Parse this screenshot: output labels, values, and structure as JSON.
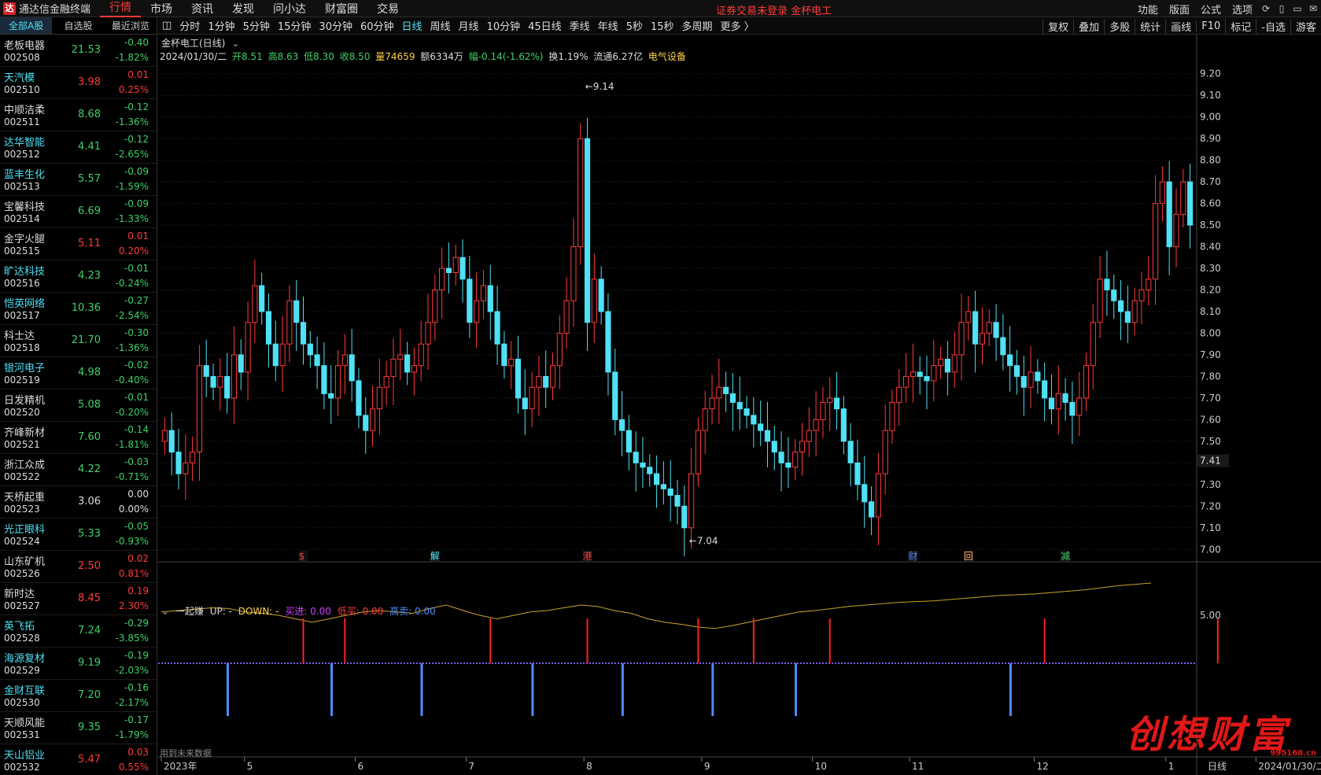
{
  "app": {
    "title": "通达信金融终端",
    "logo": "达",
    "login_warning": "证券交易未登录  金杯电工"
  },
  "menu": [
    "行情",
    "市场",
    "资讯",
    "发现",
    "问小达",
    "财富圈",
    "交易"
  ],
  "menu_active": 0,
  "right_menu": [
    "功能",
    "版面",
    "公式",
    "选项"
  ],
  "sidebar": {
    "tabs": [
      "全部A股",
      "自选股",
      "最近浏览"
    ],
    "stocks": [
      {
        "name": "老板电器",
        "code": "002508",
        "price": "21.53",
        "chg": "-0.40",
        "pct": "-1.82%",
        "dir": "dn",
        "cyan": false
      },
      {
        "name": "天汽模",
        "code": "002510",
        "price": "3.98",
        "chg": "0.01",
        "pct": "0.25%",
        "dir": "up",
        "cyan": true
      },
      {
        "name": "中顺洁柔",
        "code": "002511",
        "price": "8.68",
        "chg": "-0.12",
        "pct": "-1.36%",
        "dir": "dn",
        "cyan": false
      },
      {
        "name": "达华智能",
        "code": "002512",
        "price": "4.41",
        "chg": "-0.12",
        "pct": "-2.65%",
        "dir": "dn",
        "cyan": true
      },
      {
        "name": "蓝丰生化",
        "code": "002513",
        "price": "5.57",
        "chg": "-0.09",
        "pct": "-1.59%",
        "dir": "dn",
        "cyan": true
      },
      {
        "name": "宝馨科技",
        "code": "002514",
        "price": "6.69",
        "chg": "-0.09",
        "pct": "-1.33%",
        "dir": "dn",
        "cyan": false
      },
      {
        "name": "金字火腿",
        "code": "002515",
        "price": "5.11",
        "chg": "0.01",
        "pct": "0.20%",
        "dir": "up",
        "cyan": false
      },
      {
        "name": "旷达科技",
        "code": "002516",
        "price": "4.23",
        "chg": "-0.01",
        "pct": "-0.24%",
        "dir": "dn",
        "cyan": true
      },
      {
        "name": "恺英网络",
        "code": "002517",
        "price": "10.36",
        "chg": "-0.27",
        "pct": "-2.54%",
        "dir": "dn",
        "cyan": true
      },
      {
        "name": "科士达",
        "code": "002518",
        "price": "21.70",
        "chg": "-0.30",
        "pct": "-1.36%",
        "dir": "dn",
        "cyan": false
      },
      {
        "name": "银河电子",
        "code": "002519",
        "price": "4.98",
        "chg": "-0.02",
        "pct": "-0.40%",
        "dir": "dn",
        "cyan": true
      },
      {
        "name": "日发精机",
        "code": "002520",
        "price": "5.08",
        "chg": "-0.01",
        "pct": "-0.20%",
        "dir": "dn",
        "cyan": false
      },
      {
        "name": "齐峰新材",
        "code": "002521",
        "price": "7.60",
        "chg": "-0.14",
        "pct": "-1.81%",
        "dir": "dn",
        "cyan": false
      },
      {
        "name": "浙江众成",
        "code": "002522",
        "price": "4.22",
        "chg": "-0.03",
        "pct": "-0.71%",
        "dir": "dn",
        "cyan": false
      },
      {
        "name": "天桥起重",
        "code": "002523",
        "price": "3.06",
        "chg": "0.00",
        "pct": "0.00%",
        "dir": "flat",
        "cyan": false
      },
      {
        "name": "光正眼科",
        "code": "002524",
        "price": "5.33",
        "chg": "-0.05",
        "pct": "-0.93%",
        "dir": "dn",
        "cyan": true
      },
      {
        "name": "山东矿机",
        "code": "002526",
        "price": "2.50",
        "chg": "0.02",
        "pct": "0.81%",
        "dir": "up",
        "cyan": false
      },
      {
        "name": "新时达",
        "code": "002527",
        "price": "8.45",
        "chg": "0.19",
        "pct": "2.30%",
        "dir": "up",
        "cyan": false
      },
      {
        "name": "英飞拓",
        "code": "002528",
        "price": "7.24",
        "chg": "-0.29",
        "pct": "-3.85%",
        "dir": "dn",
        "cyan": true
      },
      {
        "name": "海源复材",
        "code": "002529",
        "price": "9.19",
        "chg": "-0.19",
        "pct": "-2.03%",
        "dir": "dn",
        "cyan": true
      },
      {
        "name": "金财互联",
        "code": "002530",
        "price": "7.20",
        "chg": "-0.16",
        "pct": "-2.17%",
        "dir": "dn",
        "cyan": true
      },
      {
        "name": "天顺风能",
        "code": "002531",
        "price": "9.35",
        "chg": "-0.17",
        "pct": "-1.79%",
        "dir": "dn",
        "cyan": false
      },
      {
        "name": "天山铝业",
        "code": "002532",
        "price": "5.47",
        "chg": "0.03",
        "pct": "0.55%",
        "dir": "up",
        "cyan": true
      }
    ]
  },
  "toolbar": {
    "periods": [
      "分时",
      "1分钟",
      "5分钟",
      "15分钟",
      "30分钟",
      "60分钟",
      "日线",
      "周线",
      "月线",
      "10分钟",
      "45日线",
      "季线",
      "年线",
      "5秒",
      "15秒",
      "多周期",
      "更多 〉"
    ],
    "active": 6,
    "right": [
      "复权",
      "叠加",
      "多股",
      "统计",
      "画线",
      "F10",
      "标记",
      "-自选",
      "游客"
    ]
  },
  "chart": {
    "title": "金杯电工(日线)",
    "info": {
      "date": "2024/01/30/二",
      "open": "开8.51",
      "high": "高8.63",
      "low": "低8.30",
      "close": "收8.50",
      "vol": "量74659",
      "amount": "额6334万",
      "range": "幅-0.14(-1.62%)",
      "turnover": "换1.19%",
      "float": "流通6.27亿",
      "sector": "电气设备"
    },
    "indicator": {
      "name": "一起赚",
      "up": "UP: -",
      "down": "DOWN: -",
      "buy": "买进: 0.00",
      "low_buy": "低买: 0.00",
      "high_sell": "高卖: 0.00"
    },
    "future_note": "用到未来数据",
    "event_marks": [
      {
        "label": "$",
        "color": "#ff3b3b",
        "i": 20
      },
      {
        "label": "解",
        "color": "#4fe1f5",
        "i": 39
      },
      {
        "label": "港",
        "color": "#ff3b3b",
        "i": 61
      },
      {
        "label": "财",
        "color": "#4f8cff",
        "i": 108
      },
      {
        "label": "回",
        "color": "#ffb060",
        "i": 116
      },
      {
        "label": "减",
        "color": "#3fd06a",
        "i": 130
      }
    ]
  },
  "chart_data": {
    "type": "candlestick",
    "ylim": [
      6.95,
      9.25
    ],
    "yticks": [
      "9.20",
      "9.10",
      "9.00",
      "8.90",
      "8.80",
      "8.70",
      "8.60",
      "8.50",
      "8.40",
      "8.30",
      "8.20",
      "8.10",
      "8.00",
      "7.90",
      "7.80",
      "7.70",
      "7.60",
      "7.50",
      "7.40",
      "7.30",
      "7.20",
      "7.10",
      "7.00"
    ],
    "xticks": [
      {
        "label": "2023年",
        "i": 0
      },
      {
        "label": "5",
        "i": 12
      },
      {
        "label": "6",
        "i": 28
      },
      {
        "label": "7",
        "i": 44
      },
      {
        "label": "8",
        "i": 61
      },
      {
        "label": "9",
        "i": 78
      },
      {
        "label": "10",
        "i": 94
      },
      {
        "label": "11",
        "i": 108
      },
      {
        "label": "12",
        "i": 126
      },
      {
        "label": "1",
        "i": 145
      },
      {
        "label": "2024/01/30/二",
        "i": 158
      }
    ],
    "last_price_label": "7.41",
    "high_label": "9.14",
    "low_label": "7.04",
    "ind_tick": "5.00",
    "axis_right_label": "日线",
    "closes": [
      7.55,
      7.45,
      7.35,
      7.4,
      7.45,
      7.85,
      7.8,
      7.75,
      7.8,
      7.7,
      7.9,
      7.82,
      8.05,
      8.22,
      8.1,
      7.95,
      7.85,
      7.95,
      8.15,
      8.05,
      7.95,
      7.9,
      7.85,
      7.72,
      7.7,
      7.85,
      7.9,
      7.78,
      7.62,
      7.55,
      7.65,
      7.75,
      7.8,
      7.88,
      7.9,
      7.82,
      7.85,
      7.95,
      8.05,
      8.2,
      8.3,
      8.28,
      8.35,
      8.25,
      8.05,
      8.15,
      8.22,
      8.1,
      7.95,
      7.85,
      7.88,
      7.7,
      7.65,
      7.75,
      7.8,
      7.75,
      7.85,
      8.0,
      8.15,
      8.4,
      8.9,
      8.05,
      8.25,
      8.1,
      7.82,
      7.6,
      7.55,
      7.45,
      7.4,
      7.38,
      7.35,
      7.3,
      7.28,
      7.25,
      7.2,
      7.1,
      7.35,
      7.55,
      7.65,
      7.7,
      7.75,
      7.72,
      7.68,
      7.65,
      7.62,
      7.58,
      7.55,
      7.5,
      7.45,
      7.4,
      7.38,
      7.45,
      7.5,
      7.55,
      7.6,
      7.68,
      7.7,
      7.65,
      7.5,
      7.4,
      7.3,
      7.22,
      7.15,
      7.35,
      7.55,
      7.68,
      7.75,
      7.8,
      7.82,
      7.8,
      7.78,
      7.85,
      7.88,
      7.82,
      7.9,
      8.05,
      8.1,
      7.95,
      8.0,
      8.05,
      7.98,
      7.9,
      7.85,
      7.8,
      7.75,
      7.82,
      7.78,
      7.7,
      7.65,
      7.72,
      7.68,
      7.62,
      7.7,
      7.85,
      8.05,
      8.25,
      8.2,
      8.15,
      8.1,
      8.05,
      8.15,
      8.2,
      8.25,
      8.6,
      8.7,
      8.4,
      8.55,
      8.7,
      8.5
    ],
    "indicator_line": [
      8.6,
      8.62,
      8.64,
      8.66,
      8.65,
      8.6,
      8.58,
      8.55,
      8.5,
      8.45,
      8.5,
      8.55,
      8.6,
      8.62,
      8.6,
      8.58,
      8.65,
      8.7,
      8.62,
      8.55,
      8.5,
      8.55,
      8.6,
      8.62,
      8.66,
      8.7,
      8.68,
      8.62,
      8.58,
      8.5,
      8.45,
      8.42,
      8.38,
      8.36,
      8.4,
      8.45,
      8.5,
      8.55,
      8.6,
      8.62,
      8.65,
      8.68,
      8.7,
      8.72,
      8.74,
      8.75,
      8.76,
      8.78,
      8.8,
      8.82,
      8.84,
      8.85,
      8.86,
      8.88,
      8.9,
      8.92,
      8.95,
      8.98,
      9.0,
      9.02
    ]
  }
}
